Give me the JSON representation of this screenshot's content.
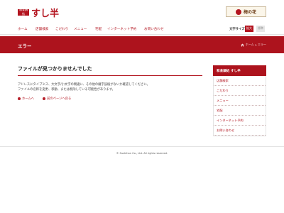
{
  "brand": {
    "badge": "和食鍋処",
    "name": "すし半",
    "banner": "梅の花"
  },
  "nav": {
    "items": [
      "ホーム",
      "店舗検索",
      "こだわり",
      "メニュー",
      "宅配",
      "インターネット予約",
      "お問い合わせ"
    ],
    "font_size_label": "文字サイズ",
    "font_large": "拡大",
    "font_standard": "標準"
  },
  "title_bar": {
    "title": "エラー",
    "breadcrumb_home": "ホーム",
    "breadcrumb_sep": ">",
    "breadcrumb_current": "エラー"
  },
  "main": {
    "heading": "ファイルが見つかりませんでした",
    "message_line1": "アドレスにタイプミス、大文字/小文字の間違い、その他の綴字誤植がないか確認してください。",
    "message_line2": "ファイルの名称を変更、移動、または削除している可能性があります。",
    "link_home": "ホームへ",
    "link_back": "前のページへ戻る"
  },
  "sidebar": {
    "heading": "和食鍋処 すし半",
    "items": [
      "店舗検索",
      "こだわり",
      "メニュー",
      "宅配",
      "インターネット予約",
      "お問い合わせ"
    ]
  },
  "footer": {
    "copyright": "© Sushihan Co., Ltd. All rights reserved."
  },
  "colors": {
    "accent": "#b3141f",
    "title_bar": "#ad131d"
  }
}
